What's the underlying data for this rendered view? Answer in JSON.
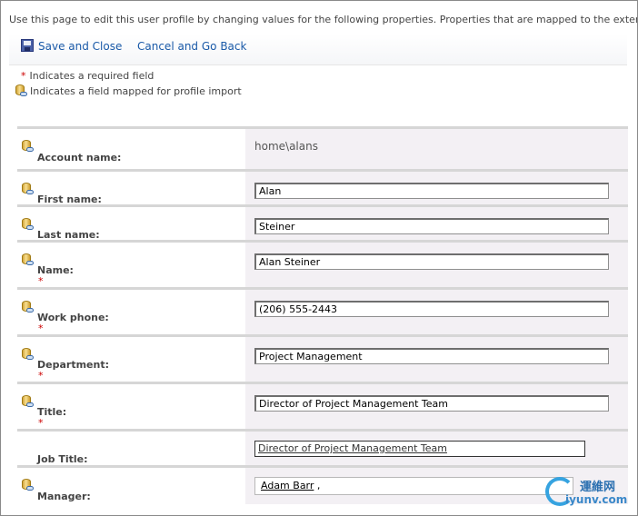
{
  "intro": "Use this page to edit this user profile by changing values for the following properties. Properties that are mapped to the external data source",
  "toolbar": {
    "save_label": "Save and Close",
    "cancel_label": "Cancel and Go Back"
  },
  "legend": {
    "required_mark": "*",
    "required_text": "Indicates a required field",
    "mapped_text": "Indicates a field mapped for profile import"
  },
  "fields": [
    {
      "label": "Account name:",
      "value": "home\\alans",
      "required": false,
      "mapped": true,
      "type": "readonly"
    },
    {
      "label": "First name:",
      "value": "Alan",
      "required": false,
      "mapped": true,
      "type": "text"
    },
    {
      "label": "Last name:",
      "value": "Steiner",
      "required": false,
      "mapped": true,
      "type": "text"
    },
    {
      "label": "Name:",
      "value": "Alan Steiner",
      "required": true,
      "mapped": true,
      "type": "text"
    },
    {
      "label": "Work phone:",
      "value": "(206) 555-2443",
      "required": true,
      "mapped": true,
      "type": "text"
    },
    {
      "label": "Department:",
      "value": "Project Management",
      "required": true,
      "mapped": true,
      "type": "text"
    },
    {
      "label": "Title:",
      "value": "Director of Project Management Team",
      "required": true,
      "mapped": true,
      "type": "text"
    },
    {
      "label": "Job Title:",
      "value": "Director of Project Management Team",
      "required": false,
      "mapped": false,
      "type": "picker"
    },
    {
      "label": "Manager:",
      "value": "Adam Barr",
      "value_suffix": " ,",
      "required": false,
      "mapped": true,
      "type": "people"
    }
  ],
  "watermark": {
    "chinese": "運維网",
    "domain": "iyunv.com"
  },
  "icons": {
    "mapped_field": "database-link-icon",
    "save": "save-icon"
  }
}
